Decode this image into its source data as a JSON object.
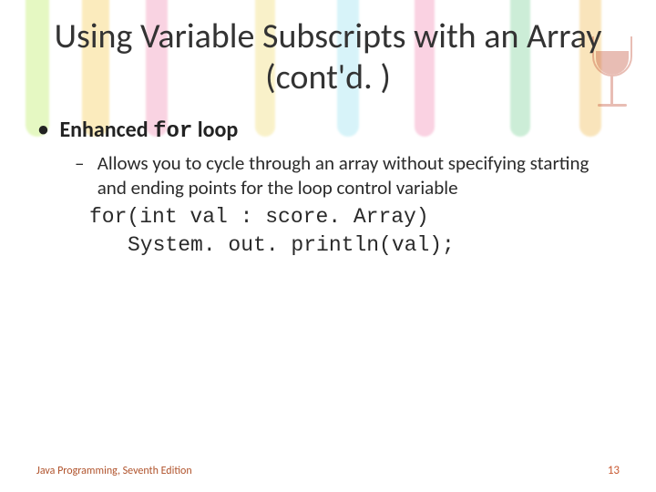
{
  "title": "Using Variable Subscripts with an Array (cont'd. )",
  "bullet1": {
    "prefix": "Enhanced ",
    "code": "for",
    "suffix": " loop"
  },
  "sub1": "Allows you to cycle through an array without specifying starting and ending points for the loop control variable",
  "code": {
    "line1": "for(int val : score. Array)",
    "line2": "System. out. println(val);"
  },
  "footer": {
    "left": "Java Programming, Seventh Edition",
    "right": "13"
  }
}
